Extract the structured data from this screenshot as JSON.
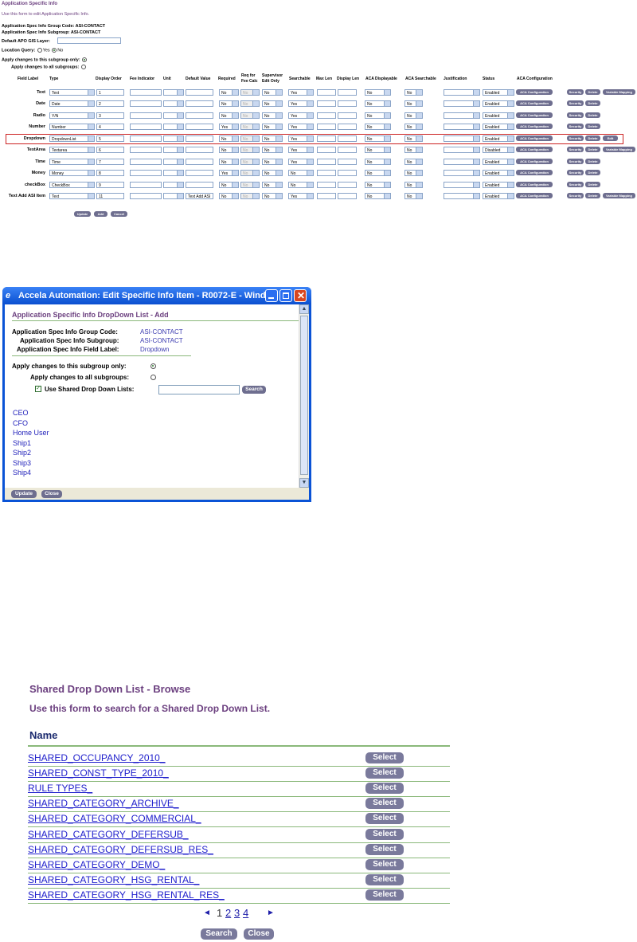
{
  "panel1": {
    "title": "Application Specific Info",
    "subtitle": "Use this form to edit Application Specific Info.",
    "group_code": "Application Spec Info Group Code: ASI-CONTACT",
    "subgroup": "Application Spec Info Subgroup: ASI-CONTACT",
    "gis_label": "Default APO GIS Layer:",
    "location_label": "Location Query:",
    "location_yes": "Yes",
    "location_no": "No",
    "apply_subgroup": "Apply changes to this subgroup only:",
    "apply_all": "Apply changes to all subgroups:",
    "headers": {
      "field_label": "Field Label",
      "type": "Type",
      "display_order": "Display Order",
      "fee_indicator": "Fee Indicator",
      "unit": "Unit",
      "default_value": "Default Value",
      "required": "Required",
      "req_fee_1": "Req for",
      "req_fee_2": "Fee Calc",
      "supervisor_1": "Supervisor",
      "supervisor_2": "Edit Only",
      "searchable": "Searchable",
      "max_len": "Max Len",
      "display_len": "Display Len",
      "aca_displayable": "ACA Displayable",
      "aca_searchable": "ACA Searchable",
      "justification": "Justification",
      "status": "Status",
      "aca_config": "ACA Configuration"
    },
    "rows": [
      {
        "label": "Text",
        "type": "Text",
        "order": "1",
        "default": "",
        "required": "No",
        "req_fee": "No",
        "supervisor": "No",
        "searchable": "Yes",
        "aca_disp": "No",
        "aca_search": "No",
        "status": "Enabled",
        "variable_mapping": true,
        "edit": false
      },
      {
        "label": "Date",
        "type": "Date",
        "order": "2",
        "default": "",
        "required": "No",
        "req_fee": "No",
        "supervisor": "No",
        "searchable": "Yes",
        "aca_disp": "No",
        "aca_search": "No",
        "status": "Enabled",
        "variable_mapping": false,
        "edit": false
      },
      {
        "label": "Radio",
        "type": "Y/N",
        "order": "3",
        "default": "",
        "required": "No",
        "req_fee": "No",
        "supervisor": "No",
        "searchable": "Yes",
        "aca_disp": "No",
        "aca_search": "No",
        "status": "Enabled",
        "variable_mapping": false,
        "edit": false
      },
      {
        "label": "Number",
        "type": "Number",
        "order": "4",
        "default": "",
        "required": "Yes",
        "req_fee": "No",
        "supervisor": "No",
        "searchable": "Yes",
        "aca_disp": "No",
        "aca_search": "No",
        "status": "Enabled",
        "variable_mapping": false,
        "edit": false
      },
      {
        "label": "Dropdown",
        "type": "DropdownList",
        "order": "5",
        "default": "",
        "required": "No",
        "req_fee": "No",
        "supervisor": "No",
        "searchable": "Yes",
        "aca_disp": "No",
        "aca_search": "No",
        "status": "Enabled",
        "variable_mapping": false,
        "edit": true
      },
      {
        "label": "TextArea",
        "type": "Textarea",
        "order": "6",
        "default": "",
        "required": "No",
        "req_fee": "No",
        "supervisor": "No",
        "searchable": "Yes",
        "aca_disp": "No",
        "aca_search": "No",
        "status": "Disabled",
        "variable_mapping": true,
        "edit": false
      },
      {
        "label": "Time",
        "type": "Time",
        "order": "7",
        "default": "",
        "required": "No",
        "req_fee": "No",
        "supervisor": "No",
        "searchable": "Yes",
        "aca_disp": "No",
        "aca_search": "No",
        "status": "Enabled",
        "variable_mapping": false,
        "edit": false
      },
      {
        "label": "Money",
        "type": "Money",
        "order": "8",
        "default": "",
        "required": "Yes",
        "req_fee": "No",
        "supervisor": "No",
        "searchable": "No",
        "aca_disp": "No",
        "aca_search": "No",
        "status": "Enabled",
        "variable_mapping": false,
        "edit": false
      },
      {
        "label": "checkBox",
        "type": "CheckBox",
        "order": "9",
        "default": "",
        "required": "No",
        "req_fee": "No",
        "supervisor": "No",
        "searchable": "No",
        "aca_disp": "No",
        "aca_search": "No",
        "status": "Enabled",
        "variable_mapping": false,
        "edit": false
      },
      {
        "label": "Text Add ASI Item",
        "type": "Text",
        "order": "11",
        "default": "Text Add ASI",
        "required": "No",
        "req_fee": "No",
        "supervisor": "No",
        "searchable": "Yes",
        "aca_disp": "No",
        "aca_search": "No",
        "status": "Enabled",
        "variable_mapping": true,
        "edit": false
      }
    ],
    "aca_btn": "ACA Configuration",
    "security_btn": "Security",
    "delete_btn": "Delete",
    "varmap_btn": "Variable Mapping",
    "edit_btn": "Edit",
    "update_btn": "Update",
    "add_btn": "Add",
    "cancel_btn": "Cancel"
  },
  "dialog": {
    "window_title": "Accela Automation: Edit Specific Info Item - R0072-E - Wind...",
    "heading": "Application Specific Info DropDown List - Add",
    "group_code_label": "Application Spec Info Group Code:",
    "group_code_value": "ASI-CONTACT",
    "subgroup_label": "Application Spec Info Subgroup:",
    "subgroup_value": "ASI-CONTACT",
    "field_label_label": "Application Spec Info Field Label:",
    "field_label_value": "Dropdown",
    "apply_subgroup": "Apply changes to this subgroup only:",
    "apply_all": "Apply changes to all subgroups:",
    "use_shared": "Use Shared Drop Down Lists:",
    "search_btn": "Search",
    "items": [
      "CEO",
      "CFO",
      "Home User",
      "Ship1",
      "Ship2",
      "Ship3",
      "Ship4"
    ],
    "update_btn": "Update",
    "close_btn": "Close"
  },
  "browse": {
    "title": "Shared Drop Down List - Browse",
    "subtitle": "Use this form to search for a Shared Drop Down List.",
    "name_header": "Name",
    "rows": [
      "SHARED_OCCUPANCY_2010_",
      "SHARED_CONST_TYPE_2010_",
      "RULE TYPES_",
      "SHARED_CATEGORY_ARCHIVE_",
      "SHARED_CATEGORY_COMMERCIAL_",
      "SHARED_CATEGORY_DEFERSUB_",
      "SHARED_CATEGORY_DEFERSUB_RES_",
      "SHARED_CATEGORY_DEMO_",
      "SHARED_CATEGORY_HSG_RENTAL_",
      "SHARED_CATEGORY_HSG_RENTAL_RES_"
    ],
    "select_btn": "Select",
    "pages": [
      "1",
      "2",
      "3",
      "4"
    ],
    "prev_glyph": "◄",
    "next_glyph": "►",
    "search_btn": "Search",
    "close_btn": "Close"
  },
  "colors": {
    "purple_title": "#6b3f7f",
    "xp_blue": "#0a53d6",
    "button_gray": "#7a7a9c",
    "link_blue": "#2020cc",
    "rule_green": "#8ab87a",
    "highlight_red": "#cc2222"
  }
}
